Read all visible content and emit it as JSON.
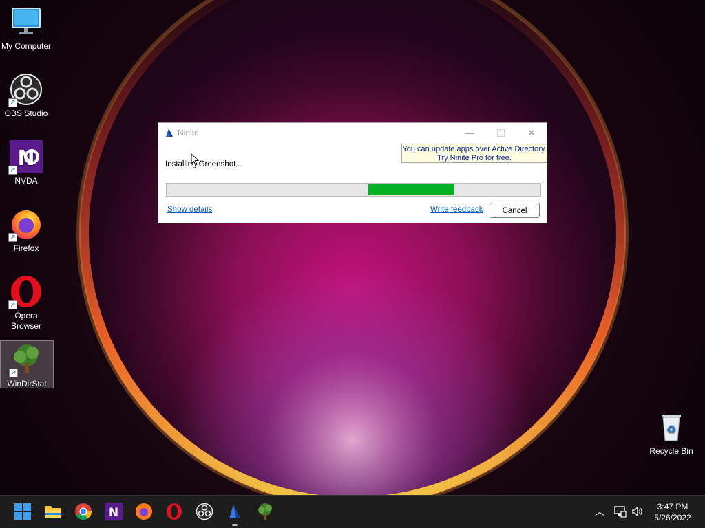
{
  "desktop": {
    "icons": [
      {
        "label": "My Computer",
        "icon": "monitor-icon",
        "shortcut": false
      },
      {
        "label": "OBS Studio",
        "icon": "obs-icon",
        "shortcut": true
      },
      {
        "label": "NVDA",
        "icon": "nvda-icon",
        "shortcut": true
      },
      {
        "label": "Firefox",
        "icon": "firefox-icon",
        "shortcut": true
      },
      {
        "label": "Opera\nBrowser",
        "icon": "opera-icon",
        "shortcut": true
      },
      {
        "label": "WinDirStat",
        "icon": "windirstat-icon",
        "shortcut": true,
        "selected": true
      },
      {
        "label": "Recycle Bin",
        "icon": "recycle-bin-icon",
        "shortcut": false
      }
    ]
  },
  "ninite": {
    "title": "Ninite",
    "ad_banner_line1": "You can update apps over Active Directory.",
    "ad_banner_line2": "Try Ninite Pro for free.",
    "status": "Installing Greenshot...",
    "progress": {
      "start": 0.54,
      "end": 0.77,
      "color": "#06b025"
    },
    "show_details_label": "Show details",
    "write_feedback_label": "Write feedback",
    "cancel_label": "Cancel",
    "window_buttons": {
      "minimize": "minimize-icon",
      "maximize": "maximize-icon",
      "close": "close-icon"
    }
  },
  "taskbar": {
    "apps": [
      "start-icon",
      "file-explorer-icon",
      "chrome-icon",
      "nvda-icon",
      "firefox-icon",
      "opera-icon",
      "obs-icon",
      "ninite-icon",
      "windirstat-icon"
    ],
    "active_app": "ninite-icon",
    "tray": [
      "chevron-up-icon",
      "network-icon",
      "volume-icon"
    ],
    "clock": {
      "time": "3:47 PM",
      "date": "5/26/2022"
    }
  },
  "colors": {
    "accent": "#0a57c5",
    "progress": "#06b025",
    "banner_bg": "#fffde1",
    "wallpaper_glow": "#c4117a"
  }
}
